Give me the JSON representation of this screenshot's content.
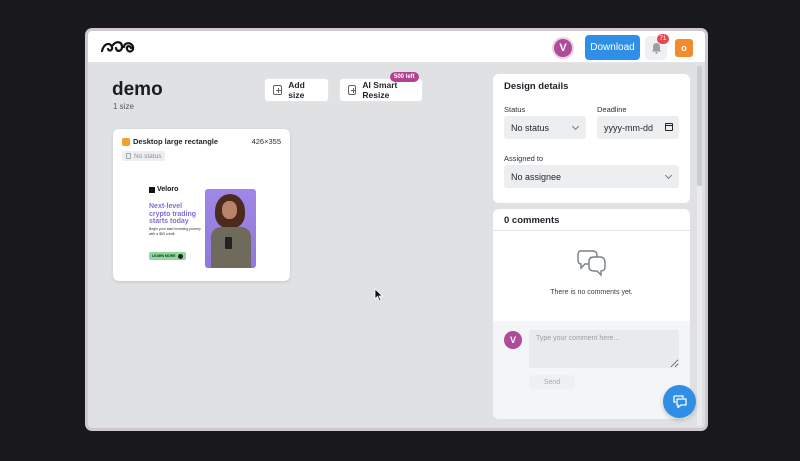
{
  "header": {
    "user_initial": "V",
    "download_label": "Download",
    "notification_count": "71",
    "org_initial": "o"
  },
  "project": {
    "title": "demo",
    "size_count": "1 size"
  },
  "actions": {
    "add_size_label": "Add size",
    "ai_resize_label": "AI Smart Resize",
    "ai_resize_badge": "500 left"
  },
  "size_card": {
    "title": "Desktop large rectangle",
    "dimensions": "426×355",
    "status": "No status",
    "ad": {
      "brand": "Veloro",
      "headline": "Next-level crypto trading starts today",
      "copy": "Begin your start investing journey with a $50 credit",
      "cta": "LEARN MORE"
    }
  },
  "design_details": {
    "heading": "Design details",
    "status_label": "Status",
    "status_value": "No status",
    "deadline_label": "Deadline",
    "deadline_placeholder": "yyyy-mm-dd",
    "assigned_label": "Assigned to",
    "assigned_value": "No assignee"
  },
  "comments": {
    "title": "0 comments",
    "empty_text": "There is no comments yet.",
    "user_initial": "V",
    "input_placeholder": "Type your comment here...",
    "send_label": "Send"
  },
  "colors": {
    "accent_blue": "#2f8fe6",
    "avatar_purple": "#b04a9b",
    "org_orange": "#f28a2e",
    "badge_magenta": "#b2418f"
  },
  "icons": {
    "logo": "brand-logo-icon",
    "bell": "bell-icon",
    "plus": "plus-square-icon",
    "comments_empty": "chat-bubbles-icon",
    "chat": "chat-icon",
    "cursor": "mouse-pointer-icon"
  }
}
